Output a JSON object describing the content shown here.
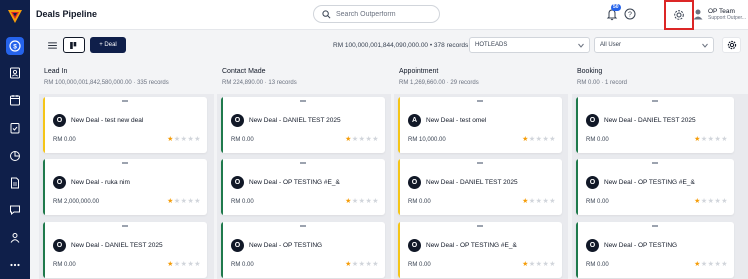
{
  "app": {
    "page_title": "Deals Pipeline",
    "search_placeholder": "Search Outperform",
    "notification_count": "50",
    "user_name": "OP Team",
    "user_role": "Support Outper..."
  },
  "colors": {
    "sidebar": "#0f1f4a",
    "active": "#2563eb",
    "highlight": "#dc2626",
    "accent_yellow": "#f5c518",
    "accent_green": "#1f7a4c"
  },
  "toolbar": {
    "add_deal_label": "+ Deal",
    "summary": "RM 100,000,001,844,090,000.00 • 378 records",
    "pipeline_filter": "HOTLEADS",
    "user_filter": "All User"
  },
  "sidebar": {
    "items": [
      "deals-icon",
      "contacts-icon",
      "calendar-icon",
      "tasks-icon",
      "reports-icon",
      "documents-icon",
      "chat-icon",
      "team-icon",
      "more-icon"
    ]
  },
  "columns": [
    {
      "title": "Lead In",
      "meta": "RM 100,000,001,842,580,000.00 · 335 records",
      "cards": [
        {
          "initial": "O",
          "name": "New Deal - test new deal",
          "amount": "RM 0.00",
          "stars": 1,
          "accent": "#f5c518"
        },
        {
          "initial": "O",
          "name": "New Deal - ruka nim",
          "amount": "RM 2,000,000.00",
          "stars": 1,
          "accent": "#1f7a4c"
        },
        {
          "initial": "O",
          "name": "New Deal - DANIEL TEST 2025",
          "amount": "RM 0.00",
          "stars": 1,
          "accent": "#1f7a4c"
        }
      ]
    },
    {
      "title": "Contact Made",
      "meta": "RM 224,890.00 · 13 records",
      "cards": [
        {
          "initial": "O",
          "name": "New Deal - DANIEL TEST 2025",
          "amount": "RM 0.00",
          "stars": 1,
          "accent": "#1f7a4c"
        },
        {
          "initial": "O",
          "name": "New Deal - OP TESTING #E_&",
          "amount": "RM 0.00",
          "stars": 1,
          "accent": "#1f7a4c"
        },
        {
          "initial": "O",
          "name": "New Deal - OP TESTING",
          "amount": "RM 0.00",
          "stars": 1,
          "accent": "#1f7a4c"
        }
      ]
    },
    {
      "title": "Appointment",
      "meta": "RM 1,269,660.00 · 29 records",
      "cards": [
        {
          "initial": "A",
          "name": "New Deal - test omel",
          "amount": "RM 10,000.00",
          "stars": 1,
          "accent": "#f5c518"
        },
        {
          "initial": "O",
          "name": "New Deal - DANIEL TEST 2025",
          "amount": "RM 0.00",
          "stars": 1,
          "accent": "#f5c518"
        },
        {
          "initial": "O",
          "name": "New Deal - OP TESTING #E_&",
          "amount": "RM 0.00",
          "stars": 1,
          "accent": "#f5c518"
        }
      ]
    },
    {
      "title": "Booking",
      "meta": "RM 0.00 · 1 record",
      "cards": [
        {
          "initial": "O",
          "name": "New Deal - DANIEL TEST 2025",
          "amount": "RM 0.00",
          "stars": 1,
          "accent": "#1f7a4c"
        },
        {
          "initial": "O",
          "name": "New Deal - OP TESTING #E_&",
          "amount": "RM 0.00",
          "stars": 1,
          "accent": "#1f7a4c"
        },
        {
          "initial": "O",
          "name": "New Deal - OP TESTING",
          "amount": "RM 0.00",
          "stars": 1,
          "accent": "#1f7a4c"
        }
      ]
    }
  ]
}
